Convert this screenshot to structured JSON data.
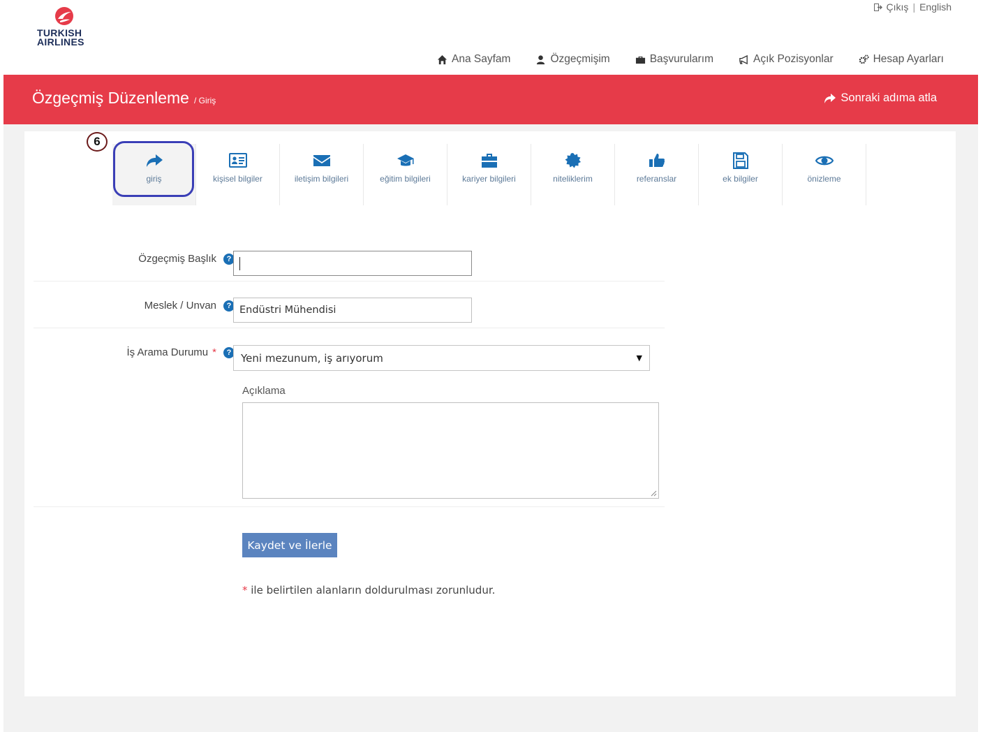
{
  "brand": {
    "line1": "TURKISH",
    "line2": "AIRLINES",
    "color": "#e63b49"
  },
  "top_links": {
    "logout": "Çıkış",
    "separator": "|",
    "language": "English"
  },
  "nav": [
    {
      "label": "Ana Sayfam",
      "icon": "home-icon"
    },
    {
      "label": "Özgeçmişim",
      "icon": "user-icon"
    },
    {
      "label": "Başvurularım",
      "icon": "briefcase-icon"
    },
    {
      "label": "Açık Pozisyonlar",
      "icon": "megaphone-icon"
    },
    {
      "label": "Hesap Ayarları",
      "icon": "gears-icon"
    }
  ],
  "banner": {
    "title": "Özgeçmiş Düzenleme",
    "subtitle": "/ Giriş",
    "skip_label": "Sonraki adıma atla"
  },
  "annotation": {
    "badge": "6"
  },
  "steps": [
    {
      "label": "giriş",
      "icon": "share-arrow-icon",
      "active": true
    },
    {
      "label": "kişisel bilgiler",
      "icon": "id-card-icon"
    },
    {
      "label": "iletişim bilgileri",
      "icon": "envelope-icon"
    },
    {
      "label": "eğitim bilgileri",
      "icon": "graduation-cap-icon"
    },
    {
      "label": "kariyer bilgileri",
      "icon": "briefcase-icon"
    },
    {
      "label": "niteliklerim",
      "icon": "badge-icon"
    },
    {
      "label": "referanslar",
      "icon": "thumbs-up-icon"
    },
    {
      "label": "ek bilgiler",
      "icon": "save-icon"
    },
    {
      "label": "önizleme",
      "icon": "eye-icon"
    }
  ],
  "form": {
    "resume_title": {
      "label": "Özgeçmiş Başlık",
      "value": ""
    },
    "profession": {
      "label": "Meslek / Unvan",
      "value": "Endüstri Mühendisi"
    },
    "job_search": {
      "label": "İş Arama Durumu",
      "required_mark": "*",
      "selected": "Yeni mezunum, iş arıyorum"
    },
    "description": {
      "label": "Açıklama",
      "value": ""
    },
    "save_label": "Kaydet ve İlerle",
    "required_note_mark": "*",
    "required_note": " ile belirtilen alanların doldurulması zorunludur."
  }
}
